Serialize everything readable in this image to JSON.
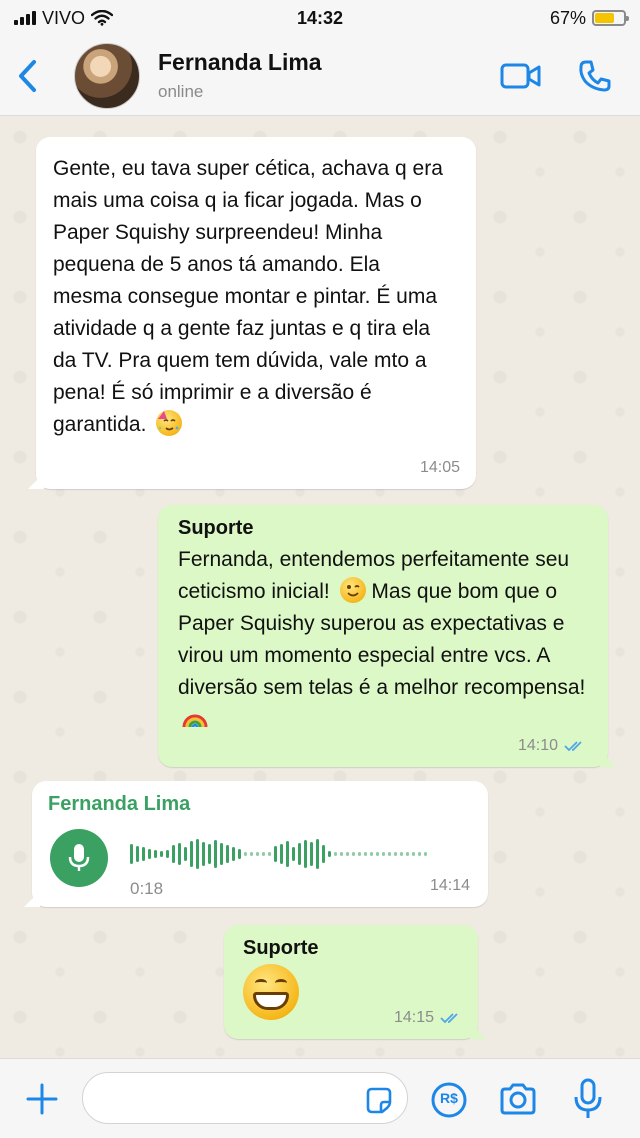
{
  "status_bar": {
    "carrier": "VIVO",
    "time": "14:32",
    "battery_percent": "67%",
    "battery_level": 0.67,
    "icons": [
      "signal-icon",
      "wifi-icon",
      "battery-icon"
    ]
  },
  "header": {
    "contact_name": "Fernanda Lima",
    "contact_status": "online",
    "icons": [
      "back-chevron-icon",
      "video-call-icon",
      "phone-call-icon"
    ]
  },
  "messages": [
    {
      "direction": "incoming",
      "text": "Gente, eu tava super cética, achava q era mais uma coisa q ia ficar jogada. Mas o Paper Squishy surpreendeu! Minha pequena de 5 anos tá amando. Ela mesma consegue montar e pintar. É uma atividade q a gente faz juntas e q tira ela da TV. Pra quem tem dúvida, vale mto a pena! É só imprimir e a diversão é garantida.",
      "emoji": "partying-face-emoji",
      "time": "14:05"
    },
    {
      "direction": "outgoing",
      "sender": "Suporte",
      "text_1": "Fernanda, entendemos perfeitamente seu ceticismo inicial!",
      "emoji_1": "winking-face-emoji",
      "text_2": "Mas que bom que o Paper Squishy superou as expectativas e virou um momento especial entre vcs. A diversão sem telas é a melhor recompensa!",
      "emoji_2": "rainbow-emoji",
      "time": "14:10",
      "status": "read"
    },
    {
      "direction": "incoming",
      "sender": "Fernanda Lima",
      "type": "voice",
      "duration": "0:18",
      "time": "14:14"
    },
    {
      "direction": "outgoing",
      "sender": "Suporte",
      "emoji": "grinning-face-emoji",
      "time": "14:15",
      "status": "read"
    }
  ],
  "input_bar": {
    "placeholder": "",
    "icons": [
      "plus-icon",
      "sticker-icon",
      "pix-payment-icon",
      "camera-icon",
      "microphone-icon"
    ],
    "pix_label": "R$"
  },
  "colors": {
    "incoming_bubble": "#ffffff",
    "outgoing_bubble": "#dcf8c6",
    "accent_blue": "#1d87e8",
    "contact_green": "#3aa162",
    "read_ticks": "#4fa6e8"
  }
}
